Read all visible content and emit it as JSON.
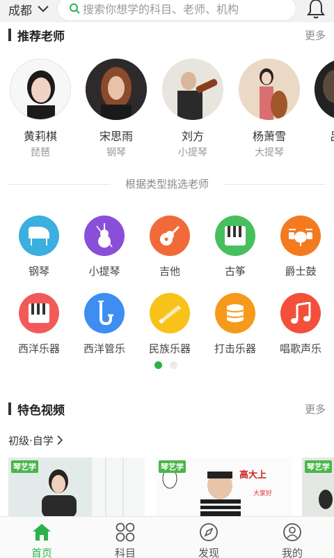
{
  "header": {
    "city": "成都",
    "search_placeholder": "搜索你想学的科目、老师、机构"
  },
  "recommended": {
    "title": "推荐老师",
    "more": "更多",
    "teachers": [
      {
        "name": "黄莉棋",
        "subject": "琵琶"
      },
      {
        "name": "宋思雨",
        "subject": "钢琴"
      },
      {
        "name": "刘方",
        "subject": "小提琴"
      },
      {
        "name": "杨萧雪",
        "subject": "大提琴"
      },
      {
        "name": "吕",
        "subject": ""
      }
    ]
  },
  "categories": {
    "title": "根据类型挑选老师",
    "items": [
      {
        "label": "钢琴",
        "icon": "piano-icon",
        "color": "#3aafe0"
      },
      {
        "label": "小提琴",
        "icon": "violin-icon",
        "color": "#8a4fd8"
      },
      {
        "label": "吉他",
        "icon": "guitar-icon",
        "color": "#f26a3a"
      },
      {
        "label": "古筝",
        "icon": "guzheng-icon",
        "color": "#45c05d"
      },
      {
        "label": "爵士鼓",
        "icon": "drum-icon",
        "color": "#f47a20"
      },
      {
        "label": "西洋乐器",
        "icon": "keyboard-icon",
        "color": "#f25a5a"
      },
      {
        "label": "西洋管乐",
        "icon": "saxophone-icon",
        "color": "#3d8ef0"
      },
      {
        "label": "民族乐器",
        "icon": "zither-icon",
        "color": "#f8c21a"
      },
      {
        "label": "打击乐器",
        "icon": "barrel-drum-icon",
        "color": "#f59a1a"
      },
      {
        "label": "唱歌声乐",
        "icon": "music-note-icon",
        "color": "#f2503a"
      }
    ]
  },
  "videos": {
    "title": "特色视频",
    "more": "更多",
    "sub_link": "初级·自学",
    "thumbs": [
      {
        "badge": "琴艺学"
      },
      {
        "badge": "琴艺学",
        "caption": "高大上"
      },
      {
        "badge": "琴艺学"
      }
    ]
  },
  "bottom_nav": [
    {
      "label": "首页",
      "icon": "home-icon"
    },
    {
      "label": "科目",
      "icon": "grid-icon"
    },
    {
      "label": "发现",
      "icon": "compass-icon"
    },
    {
      "label": "我的",
      "icon": "user-icon"
    }
  ],
  "colors": {
    "accent": "#2cb24a"
  }
}
